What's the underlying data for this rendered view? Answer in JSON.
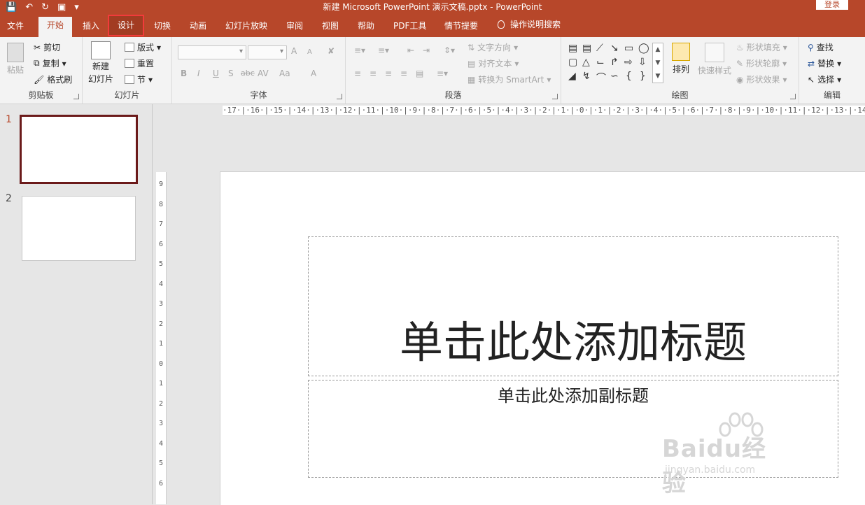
{
  "window": {
    "title": "新建 Microsoft PowerPoint 演示文稿.pptx - PowerPoint",
    "login_label": "登录",
    "qat": {
      "save_icon": "save-icon",
      "undo_icon": "undo-icon",
      "redo_icon": "redo-icon",
      "start_icon": "present-icon",
      "customize_icon": "customize-qat-icon"
    }
  },
  "tabs": [
    "文件",
    "开始",
    "插入",
    "设计",
    "切换",
    "动画",
    "幻灯片放映",
    "审阅",
    "视图",
    "帮助",
    "PDF工具",
    "情节提要"
  ],
  "active_tab": "开始",
  "highlighted_tab": "设计",
  "tell_me": "操作说明搜索",
  "ribbon": {
    "clipboard": {
      "label": "剪贴板",
      "paste": "粘贴",
      "cut": "剪切",
      "copy": "复制",
      "format_painter": "格式刷"
    },
    "slides": {
      "label": "幻灯片",
      "new_slide_line1": "新建",
      "new_slide_line2": "幻灯片",
      "layout": "版式",
      "reset": "重置",
      "section": "节"
    },
    "font": {
      "label": "字体",
      "font_name": "",
      "font_size": "",
      "bold": "B",
      "italic": "I",
      "underline": "U",
      "shadow": "S",
      "strike": "abc",
      "spacing": "AV",
      "case": "Aa",
      "color": "A",
      "grow": "A",
      "shrink": "A"
    },
    "paragraph": {
      "label": "段落",
      "text_direction": "文字方向",
      "align_text": "对齐文本",
      "smartart": "转换为 SmartArt"
    },
    "drawing": {
      "label": "绘图",
      "arrange": "排列",
      "quick_styles": "快速样式",
      "fill": "形状填充",
      "outline": "形状轮廓",
      "effects": "形状效果"
    },
    "editing": {
      "label": "编辑",
      "find": "查找",
      "replace": "替换",
      "select": "选择"
    }
  },
  "slides_pane": [
    {
      "number": "1",
      "selected": true
    },
    {
      "number": "2",
      "selected": false
    }
  ],
  "rulers": {
    "horizontal": "·17·|·16·|·15·|·14·|·13·|·12·|·11·|·10·|·9·|·8·|·7·|·6·|·5·|·4·|·3·|·2·|·1·|·0·|·1·|·2·|·3·|·4·|·5·|·6·|·7·|·8·|·9·|·10·|·11·|·12·|·13·|·14",
    "vertical": [
      "9",
      "8",
      "7",
      "6",
      "5",
      "4",
      "3",
      "2",
      "1",
      "0",
      "1",
      "2",
      "3",
      "4",
      "5",
      "6"
    ]
  },
  "slide": {
    "title_placeholder": "单击此处添加标题",
    "subtitle_placeholder": "单击此处添加副标题"
  },
  "watermark": {
    "brand": "Baidu经验",
    "url": "jingyan.baidu.com"
  },
  "colors": {
    "accent": "#b7472a",
    "highlight_box": "#f23b3b"
  }
}
